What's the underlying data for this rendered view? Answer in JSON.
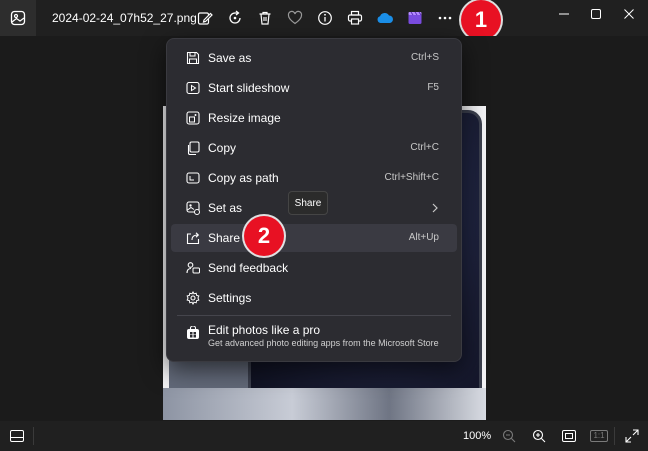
{
  "title_bar": {
    "filename": "2024-02-24_07h52_27.png",
    "toolbar_icons": [
      "edit-image-icon",
      "rotate-icon",
      "delete-icon",
      "favorite-heart-icon",
      "info-icon",
      "print-icon",
      "onedrive-cloud-icon",
      "clipchamp-icon",
      "more-options-icon"
    ],
    "window_controls": [
      "minimize-icon",
      "maximize-icon",
      "close-icon"
    ]
  },
  "annotations": {
    "badge_1": "1",
    "badge_2": "2"
  },
  "menu": {
    "items": [
      {
        "label": "Save as",
        "shortcut": "Ctrl+S",
        "icon": "save-icon"
      },
      {
        "label": "Start slideshow",
        "shortcut": "F5",
        "icon": "slideshow-icon"
      },
      {
        "label": "Resize image",
        "shortcut": "",
        "icon": "resize-icon"
      },
      {
        "label": "Copy",
        "shortcut": "Ctrl+C",
        "icon": "copy-icon"
      },
      {
        "label": "Copy as path",
        "shortcut": "Ctrl+Shift+C",
        "icon": "copy-path-icon"
      },
      {
        "label": "Set as",
        "shortcut": "",
        "icon": "set-as-icon"
      },
      {
        "label": "Share",
        "shortcut": "Alt+Up",
        "icon": "share-icon"
      },
      {
        "label": "Send feedback",
        "shortcut": "",
        "icon": "feedback-icon"
      },
      {
        "label": "Settings",
        "shortcut": "",
        "icon": "settings-gear-icon"
      }
    ],
    "promo": {
      "title": "Edit photos like a pro",
      "subtitle": "Get advanced photo editing apps from the Microsoft Store",
      "icon": "store-icon"
    }
  },
  "tooltip": {
    "text": "Share"
  },
  "bottom_bar": {
    "zoom": "100%",
    "actual_size_label": "1:1"
  },
  "colors": {
    "badge": "#e81123",
    "onedrive": "#1b8fe8",
    "clipchamp": "#7a4ce0"
  }
}
